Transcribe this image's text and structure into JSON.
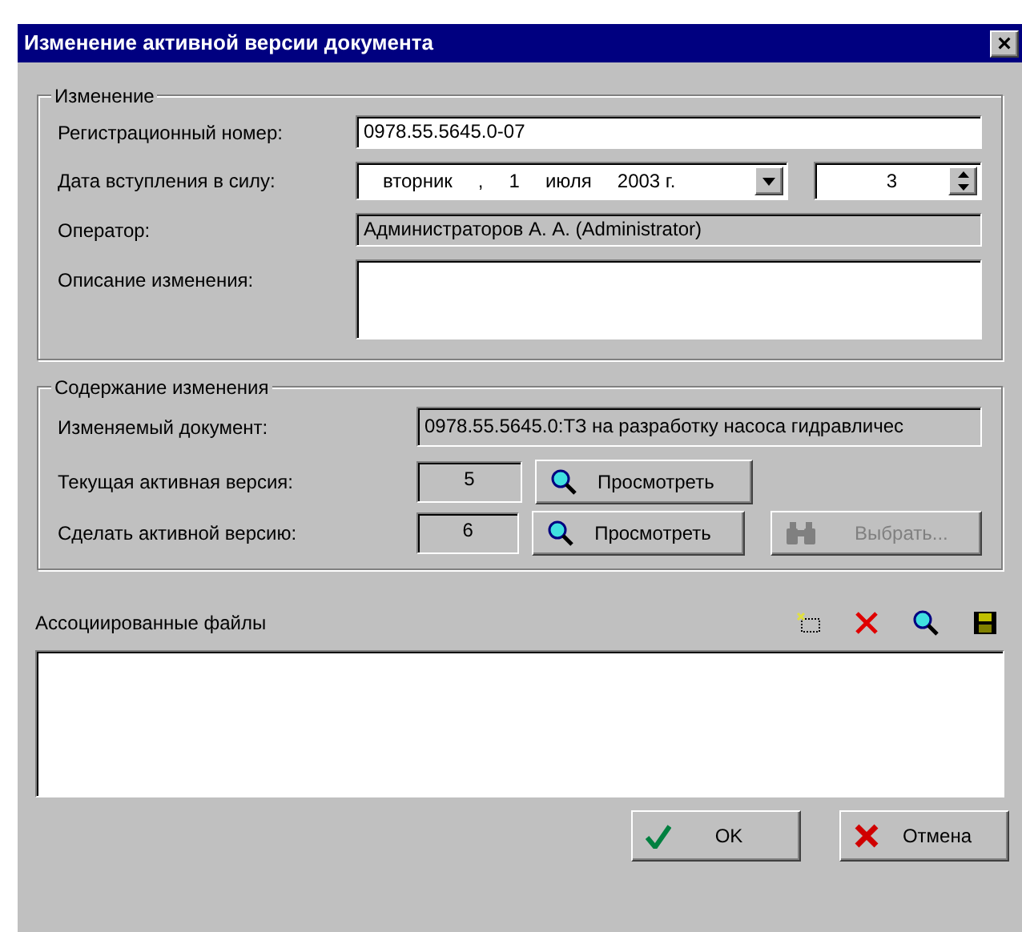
{
  "window": {
    "title": "Изменение активной версии документа",
    "close": "×"
  },
  "change_group": {
    "title": "Изменение",
    "fields": [
      {
        "kind": "text",
        "label": "Регистрационный номер:",
        "value": "0978.55.5645.0-07"
      },
      {
        "kind": "date",
        "label": "Дата вступления в силу:",
        "parts": [
          "вторник",
          ",",
          "1",
          "июля",
          "2003 г."
        ],
        "spinner_value": "3"
      },
      {
        "kind": "readonly",
        "label": "Оператор:",
        "value": "Администраторов А. А. (Administrator)"
      },
      {
        "kind": "multiline",
        "label": "Описание изменения:"
      }
    ]
  },
  "content_group": {
    "title": "Содержание изменения",
    "document": {
      "label": "Изменяемый документ:",
      "value": "0978.55.5645.0:ТЗ на разработку насоса гидравличес"
    },
    "versions": [
      {
        "label": "Текущая активная версия:",
        "value": "5",
        "view_button": "Просмотреть"
      },
      {
        "label": "Сделать активной версию:",
        "value": "6",
        "view_button": "Просмотреть",
        "select_button": {
          "label": "Выбрать...",
          "disabled": true
        }
      }
    ]
  },
  "files": {
    "label": "Ассоциированные файлы"
  },
  "buttons": [
    {
      "kind": "ok",
      "label": "OK"
    },
    {
      "kind": "cancel",
      "label": "Отмена"
    }
  ]
}
